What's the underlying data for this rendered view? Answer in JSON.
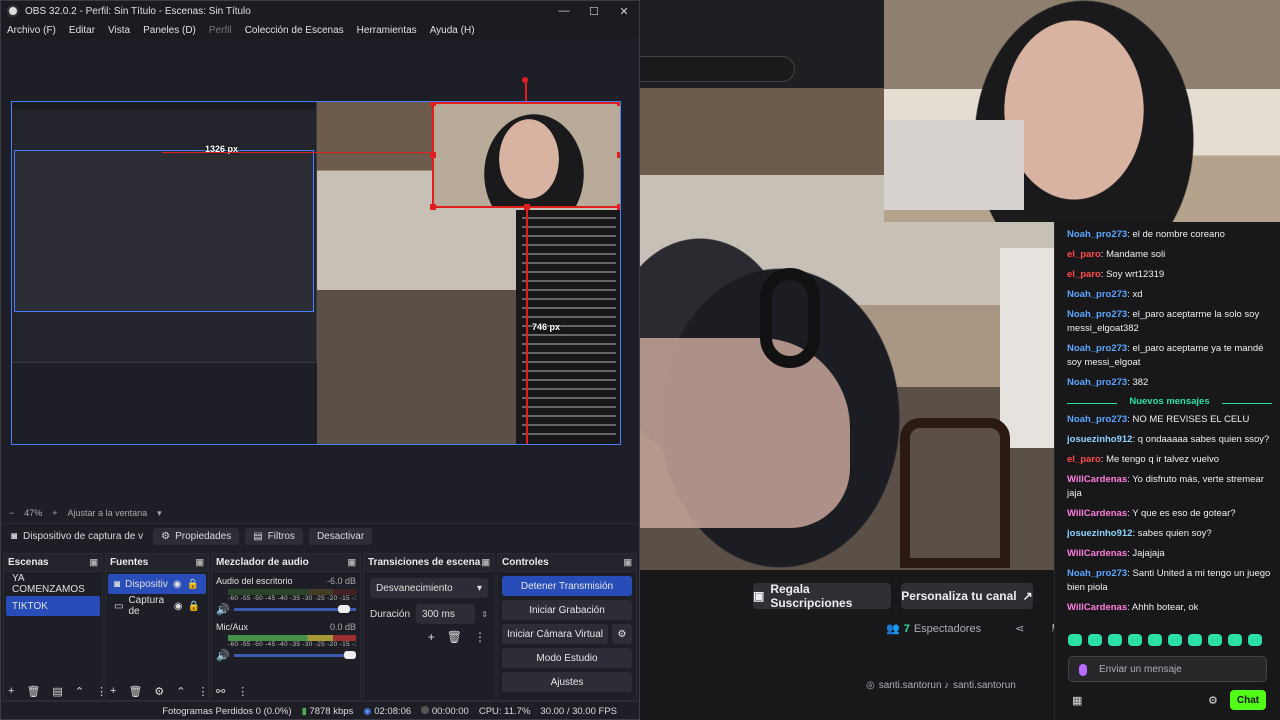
{
  "obs": {
    "title": "OBS 32.0.2 - Perfil: Sin Título - Escenas: Sin Título",
    "menu": [
      "Archivo (F)",
      "Editar",
      "Vista",
      "Paneles (D)",
      "Perfil",
      "Colección de Escenas",
      "Herramientas",
      "Ayuda (H)"
    ],
    "preview": {
      "measure_top": "1326 px",
      "measure_bottom": "746 px",
      "zoom": "47%",
      "zoom_option": "Ajustar a la ventana"
    },
    "source_bar": {
      "selected_source": "Dispositivo de captura de v",
      "properties": "Propiedades",
      "filters": "Filtros",
      "deactivate": "Desactivar"
    },
    "scenes": {
      "title": "Escenas",
      "items": [
        "YA COMENZAMOS",
        "TIKTOK"
      ],
      "selected": "TIKTOK"
    },
    "sources": {
      "title": "Fuentes",
      "items": [
        "Dispositiv",
        "Captura de"
      ]
    },
    "mixer": {
      "title": "Mezclador de audio",
      "channels": [
        {
          "name": "Audio del escritorio",
          "db": "-6.0 dB",
          "level": 0.95
        },
        {
          "name": "Mic/Aux",
          "db": "0.0 dB",
          "level": 1.0
        }
      ],
      "scale": "-60 -55 -50 -45 -40 -35 -30 -25 -20 -15 -10 -5 0"
    },
    "transitions": {
      "title": "Transiciones de escena",
      "type": "Desvanecimiento",
      "duration_label": "Duración",
      "duration": "300 ms"
    },
    "controls": {
      "title": "Controles",
      "buttons": [
        "Detener Transmisión",
        "Iniciar Grabación",
        "Iniciar Cámara Virtual",
        "Modo Estudio",
        "Ajustes"
      ]
    },
    "status": {
      "dropped": "Fotogramas Perdidos 0 (0.0%)",
      "kbps": "7878 kbps",
      "stream_time": "02:08:06",
      "rec_time": "00:00:00",
      "cpu": "CPU: 11.7%",
      "fps": "30.00 / 30.00 FPS"
    }
  },
  "stream": {
    "gift_subs": "Regala Suscripciones",
    "customize": "Personaliza tu canal",
    "viewers_count": "7",
    "viewers_label": "Espectadores",
    "social_1": "santi.santorun",
    "social_2": "santi.santorun",
    "chat": {
      "messages_before": [
        {
          "user": "Noah_pro273",
          "text": "el de nombre coreano",
          "color": "#5ba7ff"
        },
        {
          "user": "el_paro",
          "text": "Mandame soli",
          "color": "#ff4a4a"
        },
        {
          "user": "el_paro",
          "text": "Soy wrt12319",
          "color": "#ff4a4a"
        },
        {
          "user": "Noah_pro273",
          "text": "xd",
          "color": "#5ba7ff"
        },
        {
          "user": "Noah_pro273",
          "text": "el_paro aceptarme la solo soy messi_elgoat382",
          "color": "#5ba7ff"
        },
        {
          "user": "Noah_pro273",
          "text": "el_paro aceptame ya te mandé soy messi_elgoat",
          "color": "#5ba7ff"
        },
        {
          "user": "Noah_pro273",
          "text": "382",
          "color": "#5ba7ff"
        }
      ],
      "divider": "Nuevos mensajes",
      "messages_after": [
        {
          "user": "Noah_pro273",
          "text": "NO ME REVISES EL CELU",
          "color": "#5ba7ff"
        },
        {
          "user": "josuezinho912",
          "text": "q ondaaaaa sabes quien ssoy?",
          "color": "#8fd3ff"
        },
        {
          "user": "el_paro",
          "text": "Me tengo q ir talvez vuelvo",
          "color": "#ff4a4a"
        },
        {
          "user": "WillCardenas",
          "text": "Yo disfruto más, verte stremear jaja",
          "color": "#ff7edb"
        },
        {
          "user": "WillCardenas",
          "text": "Y que es eso de gotear?",
          "color": "#ff7edb"
        },
        {
          "user": "josuezinho912",
          "text": "sabes quien soy?",
          "color": "#8fd3ff"
        },
        {
          "user": "WillCardenas",
          "text": "Jajajaja",
          "color": "#ff7edb"
        },
        {
          "user": "Noah_pro273",
          "text": "Santi United a mi tengo un juego bien piola",
          "color": "#5ba7ff"
        },
        {
          "user": "WillCardenas",
          "text": "Ahhh botear, ok",
          "color": "#ff7edb"
        }
      ],
      "input_placeholder": "Enviar un mensaje",
      "chat_button": "Chat"
    }
  }
}
